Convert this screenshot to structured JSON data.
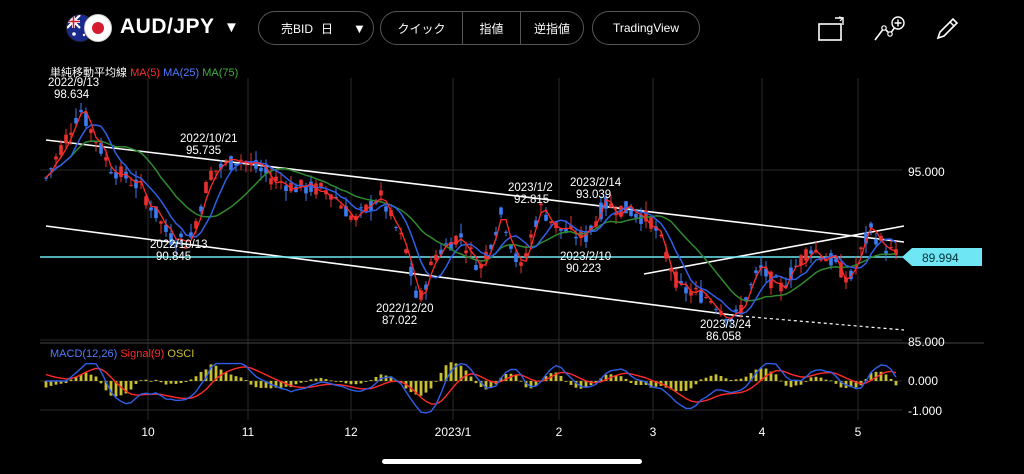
{
  "header": {
    "symbol": "AUD/JPY",
    "order_type": "売BID",
    "timeframe": "日",
    "quick_label": "クイック",
    "limit_label": "指値",
    "stop_label": "逆指値",
    "tradingview_label": "TradingView"
  },
  "indicator_legend": {
    "title": "単純移動平均線",
    "ma5": "MA(5)",
    "ma25": "MA(25)",
    "ma75": "MA(75)"
  },
  "macd_legend": {
    "macd": "MACD(12,26)",
    "signal": "Signal(9)",
    "osci": "OSCI"
  },
  "price_axis": [
    "95.000",
    "85.000"
  ],
  "current_price": "89.994",
  "macd_axis": [
    "0.000",
    "-1.000"
  ],
  "time_axis": [
    "10",
    "11",
    "12",
    "2023/1",
    "2",
    "3",
    "4",
    "5"
  ],
  "annotations": [
    {
      "date": "2022/9/13",
      "value": "98.634"
    },
    {
      "date": "2022/10/21",
      "value": "95.735"
    },
    {
      "date": "2022/10/13",
      "value": "90.845"
    },
    {
      "date": "2022/12/20",
      "value": "87.022"
    },
    {
      "date": "2023/1/2",
      "value": "92.815"
    },
    {
      "date": "2023/2/14",
      "value": "93.039"
    },
    {
      "date": "2023/2/10",
      "value": "90.223"
    },
    {
      "date": "2023/3/24",
      "value": "86.058"
    }
  ],
  "colors": {
    "up": "#3a7df2",
    "down": "#e83030",
    "ma5": "#ff2a2a",
    "ma25": "#2f5fe8",
    "ma75": "#2f8a2f",
    "price_line": "#6fe6f3",
    "osci": "#c8c030"
  },
  "icons": [
    "chart-window-icon",
    "drawing-tool-add-icon",
    "pencil-icon",
    "dropdown-caret-icon"
  ]
}
